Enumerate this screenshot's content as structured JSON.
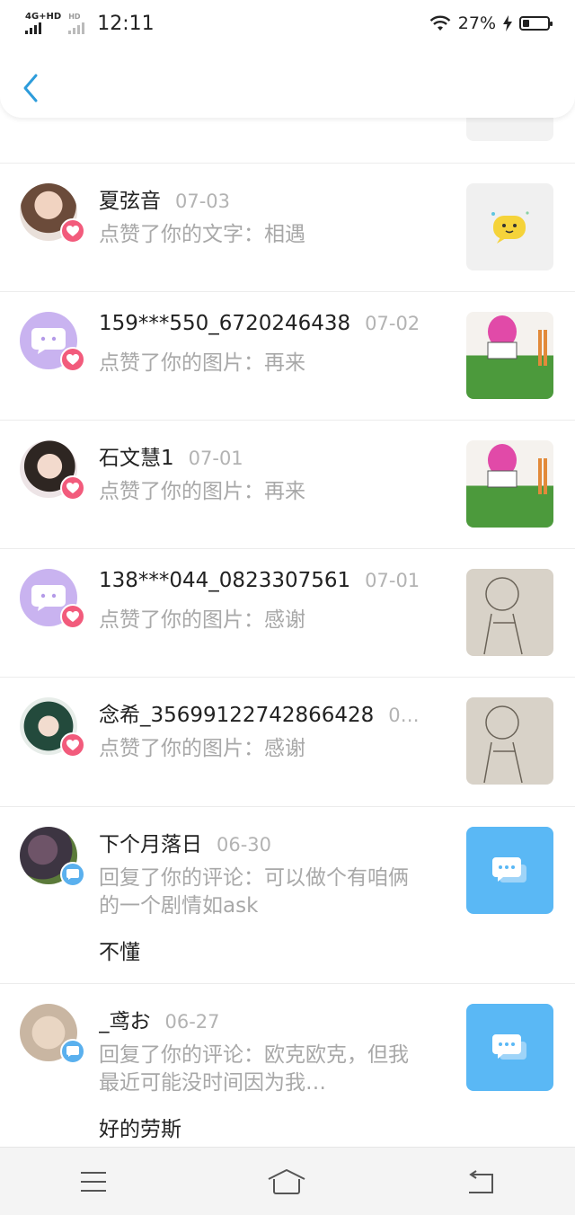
{
  "status_bar": {
    "network": "4G+HD",
    "network2": "HD",
    "time": "12:11",
    "battery": "27%"
  },
  "notifications": [
    {
      "name": "夏弦音",
      "date": "07-03",
      "action": "点赞了你的文字：相遇"
    },
    {
      "name": "159***550_6720246438",
      "date": "07-02",
      "action": "点赞了你的图片：再来"
    },
    {
      "name": "石文慧1",
      "date": "07-01",
      "action": "点赞了你的图片：再来"
    },
    {
      "name": "138***044_0823307561",
      "date": "07-01",
      "action": "点赞了你的图片：感谢"
    },
    {
      "name": "念希_35699122742866428",
      "date": "0…",
      "action": "点赞了你的图片：感谢"
    },
    {
      "name": "下个月落日",
      "date": "06-30",
      "action": "回复了你的评论：可以做个有咱俩的一个剧情如ask",
      "reply": "不懂"
    },
    {
      "name": "_鸢お",
      "date": "06-27",
      "action": "回复了你的评论：欧克欧克，但我最近可能没时间因为我…",
      "reply": "好的劳斯"
    }
  ],
  "icons": {
    "like_badge": "heart-icon",
    "reply_badge": "chat-bubble-icon",
    "back": "chevron-left-icon",
    "nav": [
      "menu-icon",
      "home-icon",
      "return-icon"
    ]
  },
  "colors": {
    "accent": "#2d9cdb",
    "like": "#f25b7c",
    "reply": "#5ab0ee",
    "muted": "#a8a8a8"
  }
}
